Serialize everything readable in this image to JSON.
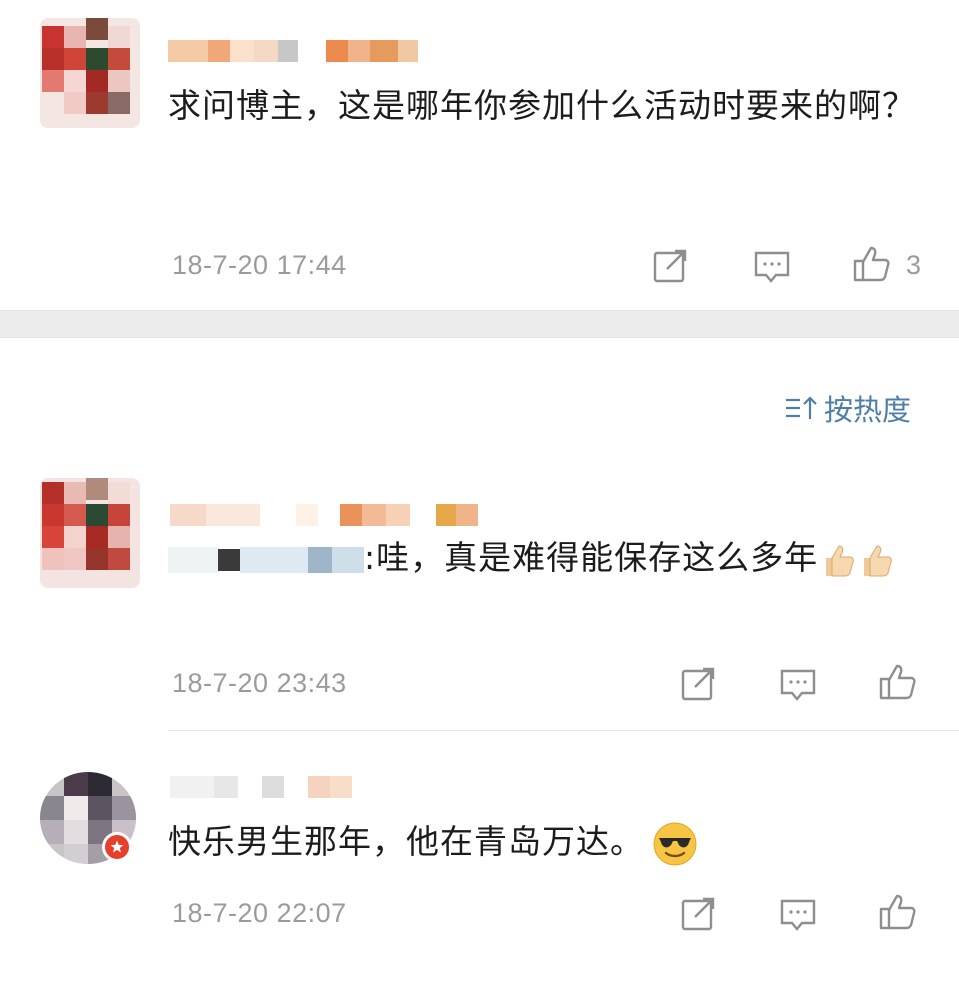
{
  "comments": [
    {
      "text": "求问博主，这是哪年你参加什么活动时要来的啊？",
      "timestamp": "18-7-20 17:44",
      "like_count": "3"
    },
    {
      "text_tail": ":哇，真是难得能保存这么多年",
      "timestamp": "18-7-20 23:43",
      "like_count": ""
    },
    {
      "text": "快乐男生那年，他在青岛万达。",
      "timestamp": "18-7-20 22:07",
      "like_count": ""
    }
  ],
  "sort": {
    "label": "按热度"
  },
  "icons": {
    "share": "share-icon",
    "comment": "comment-icon",
    "like": "thumbs-up-icon",
    "sort": "sort-icon"
  },
  "colors": {
    "accent": "#4d7ea8",
    "timestamp": "#9b9b9b",
    "divider": "#ececec",
    "badge": "#e6402b"
  }
}
